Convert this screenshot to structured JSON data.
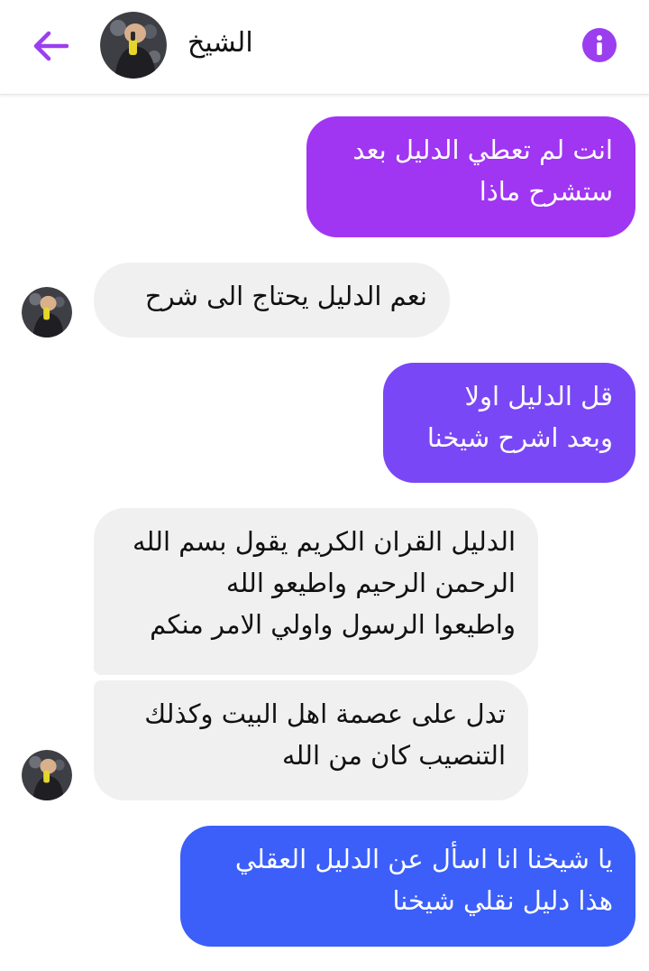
{
  "header": {
    "title": "الشيخ",
    "back_icon": "arrow-left-icon",
    "info_icon": "info-icon",
    "accent": "#9b3ef0"
  },
  "messages": [
    {
      "from": "me",
      "lines": [
        "انت لم تعطي الدليل بعد",
        "ستشرح ماذا"
      ]
    },
    {
      "from": "them",
      "lines": [
        "نعم الدليل يحتاج الى شرح"
      ]
    },
    {
      "from": "me",
      "lines": [
        "قل الدليل اولا",
        "وبعد اشرح شيخنا"
      ]
    },
    {
      "from": "them",
      "lines": [
        "الدليل القران الكريم يقول بسم الله",
        "الرحمن الرحيم واطيعو الله",
        "واطيعوا الرسول واولي الامر منكم"
      ]
    },
    {
      "from": "them",
      "lines": [
        "تدل على عصمة اهل البيت وكذلك",
        "التنصيب كان من الله"
      ]
    },
    {
      "from": "me",
      "lines": [
        "يا شيخنا انا اسأل عن الدليل العقلي",
        "هذا دليل نقلي شيخنا"
      ]
    }
  ],
  "colors": {
    "outgoing_1": "#a035f2",
    "outgoing_2": "#7a47f6",
    "outgoing_3": "#3b5ff8",
    "incoming": "#f0f0f0"
  }
}
